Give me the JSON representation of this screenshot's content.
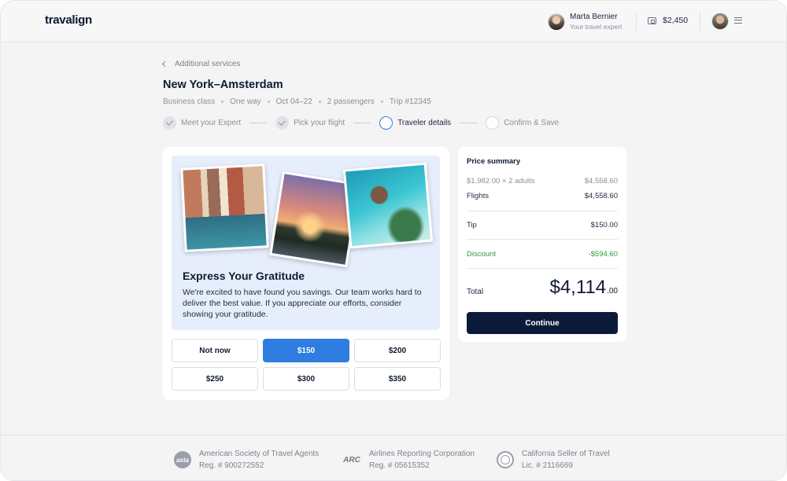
{
  "header": {
    "logo": "travalign",
    "expert_name": "Marta Bernier",
    "expert_role": "Your travel expert",
    "wallet_balance": "$2,450"
  },
  "breadcrumb": {
    "back_label": "Additional services"
  },
  "trip": {
    "title": "New York–Amsterdam",
    "meta": [
      "Business class",
      "One way",
      "Oct 04–22",
      "2 passengers",
      "Trip #12345"
    ]
  },
  "stepper": {
    "steps": [
      {
        "label": "Meet your Expert",
        "state": "done"
      },
      {
        "label": "Pick your flight",
        "state": "done"
      },
      {
        "label": "Traveler details",
        "state": "active"
      },
      {
        "label": "Confirm & Save",
        "state": "pending"
      }
    ]
  },
  "tip": {
    "title": "Express Your Gratitude",
    "text": "We're excited to have found you savings. Our team works hard to deliver the best value. If you appreciate our efforts, consider showing your gratitude.",
    "options": [
      "Not now",
      "$150",
      "$200",
      "$250",
      "$300",
      "$350"
    ],
    "selected": "$150"
  },
  "price_summary": {
    "title": "Price summary",
    "fare_label": "$1,982.00 × 2 adults",
    "fare_value": "$4,558.60",
    "flights_label": "Flights",
    "flights_value": "$4,558.60",
    "tip_label": "Tip",
    "tip_value": "$150.00",
    "discount_label": "Discount",
    "discount_value": "-$594.60",
    "total_label": "Total",
    "total_whole": "$4,114",
    "total_cents": ".00",
    "continue_label": "Continue"
  },
  "footer": {
    "accreditations": [
      {
        "logo": "asta",
        "name": "American Society of Travel Agents",
        "reg": "Reg. # 900272552"
      },
      {
        "logo": "ARC",
        "name": "Airlines Reporting Corporation",
        "reg": "Reg. # 05615352"
      },
      {
        "logo": "california-seal-icon",
        "name": "California Seller of Travel",
        "reg": "Lic. # 2116669"
      }
    ]
  },
  "colors": {
    "accent": "#2f7de1",
    "primary_button": "#0c1a3a",
    "discount": "#2e9a3e",
    "hero_background": "#e7eefb"
  }
}
